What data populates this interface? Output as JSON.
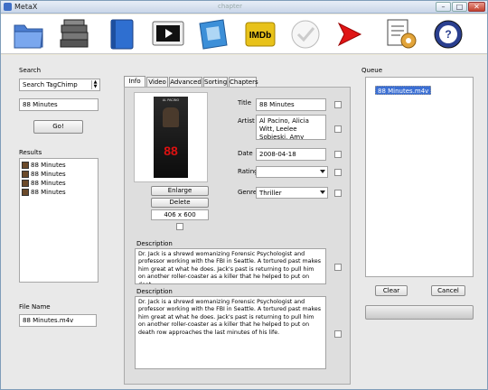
{
  "window": {
    "title": "MetaX",
    "ghost_title": "chapter"
  },
  "toolbar": {
    "buttons": [
      {
        "name": "open-folder",
        "icon": "folder-icon"
      },
      {
        "name": "batch",
        "icon": "stacked-books-icon"
      },
      {
        "name": "book",
        "icon": "book-icon"
      },
      {
        "name": "video",
        "icon": "video-screen-icon"
      },
      {
        "name": "film",
        "icon": "film-strip-icon"
      },
      {
        "name": "imdb",
        "icon": "imdb-icon",
        "label": "IMDb"
      },
      {
        "name": "check",
        "icon": "check-icon"
      },
      {
        "name": "write",
        "icon": "red-arrow-icon"
      },
      {
        "name": "report",
        "icon": "document-gear-icon"
      },
      {
        "name": "help",
        "icon": "help-icon"
      }
    ]
  },
  "search": {
    "heading": "Search",
    "source": "Search TagChimp",
    "query": "88 Minutes",
    "go_label": "Go!"
  },
  "results": {
    "heading": "Results",
    "items": [
      "88 Minutes",
      "88 Minutes",
      "88 Minutes",
      "88 Minutes"
    ]
  },
  "file": {
    "heading": "File Name",
    "value": "88 Minutes.m4v"
  },
  "tabs": [
    "Info",
    "Video",
    "Advanced",
    "Sorting",
    "Chapters"
  ],
  "info": {
    "poster_title": "AL PACINO",
    "poster_number": "88",
    "enlarge_label": "Enlarge",
    "delete_label": "Delete",
    "dimensions": "406 x 600",
    "title_label": "Title",
    "title_value": "88 Minutes",
    "artist_label": "Artist",
    "artist_value": "Al Pacino, Alicia Witt, Leelee Sobieski, Amy",
    "date_label": "Date",
    "date_value": "2008-04-18",
    "rating_label": "Rating",
    "rating_value": "",
    "genre_label": "Genre",
    "genre_value": "Thriller",
    "short_desc_label": "Description",
    "short_desc": "Dr. Jack is a shrewd womanizing Forensic Psychologist and professor working with the FBI in Seattle. A tortured past makes him great at what he does. Jack's past is returning to pull him on another roller-coaster as a killer that he helped to put on deat",
    "long_desc_label": "Description",
    "long_desc": "Dr. Jack is a shrewd womanizing Forensic Psychologist and professor working with the FBI in Seattle. A tortured past makes him great at what he does. Jack's past is returning to pull him on another roller-coaster as a killer that he helped to put on death row approaches the last minutes of his life."
  },
  "queue": {
    "heading": "Queue",
    "items": [
      "88 Minutes.m4v"
    ],
    "clear_label": "Clear",
    "cancel_label": "Cancel"
  }
}
